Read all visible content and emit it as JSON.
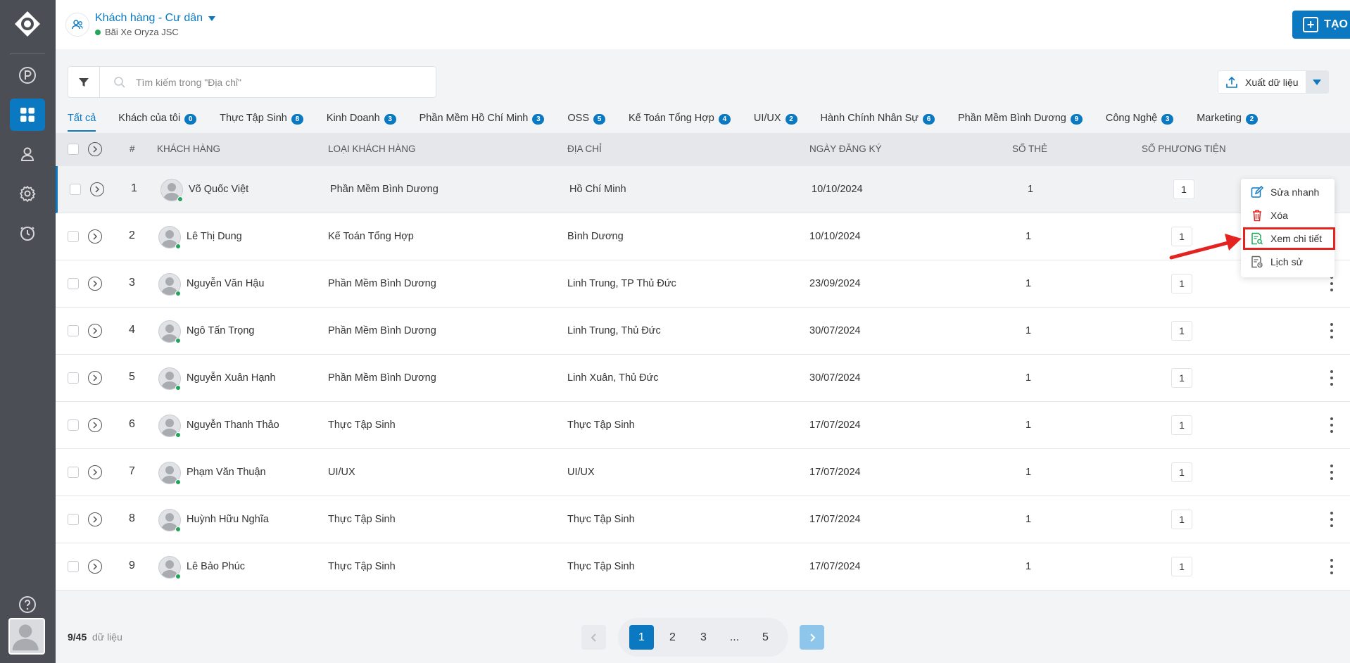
{
  "header": {
    "title": "Khách hàng - Cư dân",
    "subtitle": "Bãi Xe Oryza JSC",
    "new_button": "TẠO MỚI"
  },
  "search": {
    "placeholder": "Tìm kiếm trong \"Địa chỉ\""
  },
  "export": {
    "label": "Xuất dữ liệu"
  },
  "tabs": [
    {
      "label": "Tất cả",
      "count": ""
    },
    {
      "label": "Khách của tôi",
      "count": "0"
    },
    {
      "label": "Thực Tập Sinh",
      "count": "8"
    },
    {
      "label": "Kinh Doanh",
      "count": "3"
    },
    {
      "label": "Phần Mềm Hồ Chí Minh",
      "count": "3"
    },
    {
      "label": "OSS",
      "count": "5"
    },
    {
      "label": "Kế Toán Tổng Hợp",
      "count": "4"
    },
    {
      "label": "UI/UX",
      "count": "2"
    },
    {
      "label": "Hành Chính Nhân Sự",
      "count": "6"
    },
    {
      "label": "Phần Mềm Bình Dương",
      "count": "9"
    },
    {
      "label": "Công Nghệ",
      "count": "3"
    },
    {
      "label": "Marketing",
      "count": "2"
    }
  ],
  "table": {
    "columns": {
      "index": "#",
      "customer": "KHÁCH HÀNG",
      "type": "LOẠI KHÁCH HÀNG",
      "address": "ĐỊA CHỈ",
      "date": "NGÀY ĐĂNG KÝ",
      "cards": "SỐ THẺ",
      "vehicles": "SỐ PHƯƠNG TIỆN"
    },
    "rows": [
      {
        "index": "1",
        "customer": "Võ Quốc Việt",
        "type": "Phần Mềm Bình Dương",
        "address": "Hồ Chí Minh",
        "date": "10/10/2024",
        "cards": "1",
        "vehicles": "1"
      },
      {
        "index": "2",
        "customer": "Lê Thị Dung",
        "type": "Kế Toán Tổng Hợp",
        "address": "Bình Dương",
        "date": "10/10/2024",
        "cards": "1",
        "vehicles": "1"
      },
      {
        "index": "3",
        "customer": "Nguyễn Văn Hậu",
        "type": "Phần Mềm Bình Dương",
        "address": "Linh Trung, TP Thủ Đức",
        "date": "23/09/2024",
        "cards": "1",
        "vehicles": "1"
      },
      {
        "index": "4",
        "customer": "Ngô Tấn Trọng",
        "type": "Phần Mềm Bình Dương",
        "address": "Linh Trung, Thủ Đức",
        "date": "30/07/2024",
        "cards": "1",
        "vehicles": "1"
      },
      {
        "index": "5",
        "customer": "Nguyễn Xuân Hạnh",
        "type": "Phần Mềm Bình Dương",
        "address": "Linh Xuân, Thủ Đức",
        "date": "30/07/2024",
        "cards": "1",
        "vehicles": "1"
      },
      {
        "index": "6",
        "customer": "Nguyễn Thanh Thảo",
        "type": "Thực Tập Sinh",
        "address": "Thực Tập Sinh",
        "date": "17/07/2024",
        "cards": "1",
        "vehicles": "1"
      },
      {
        "index": "7",
        "customer": "Phạm Văn Thuận",
        "type": "UI/UX",
        "address": "UI/UX",
        "date": "17/07/2024",
        "cards": "1",
        "vehicles": "1"
      },
      {
        "index": "8",
        "customer": "Huỳnh Hữu Nghĩa",
        "type": "Thực Tập Sinh",
        "address": "Thực Tập Sinh",
        "date": "17/07/2024",
        "cards": "1",
        "vehicles": "1"
      },
      {
        "index": "9",
        "customer": "Lê Bảo Phúc",
        "type": "Thực Tập Sinh",
        "address": "Thực Tập Sinh",
        "date": "17/07/2024",
        "cards": "1",
        "vehicles": "1"
      }
    ]
  },
  "context_menu": {
    "quick_edit": "Sửa nhanh",
    "delete": "Xóa",
    "view_detail": "Xem chi tiết",
    "history": "Lịch sử"
  },
  "pagination": {
    "shown": "9/45",
    "suffix": "dữ liệu",
    "pages": [
      "1",
      "2",
      "3",
      "...",
      "5"
    ],
    "current": "1"
  },
  "colors": {
    "primary": "#0b79c2",
    "sidebar": "#4b4f55",
    "online": "#22a55a",
    "highlight": "#e4221f"
  }
}
